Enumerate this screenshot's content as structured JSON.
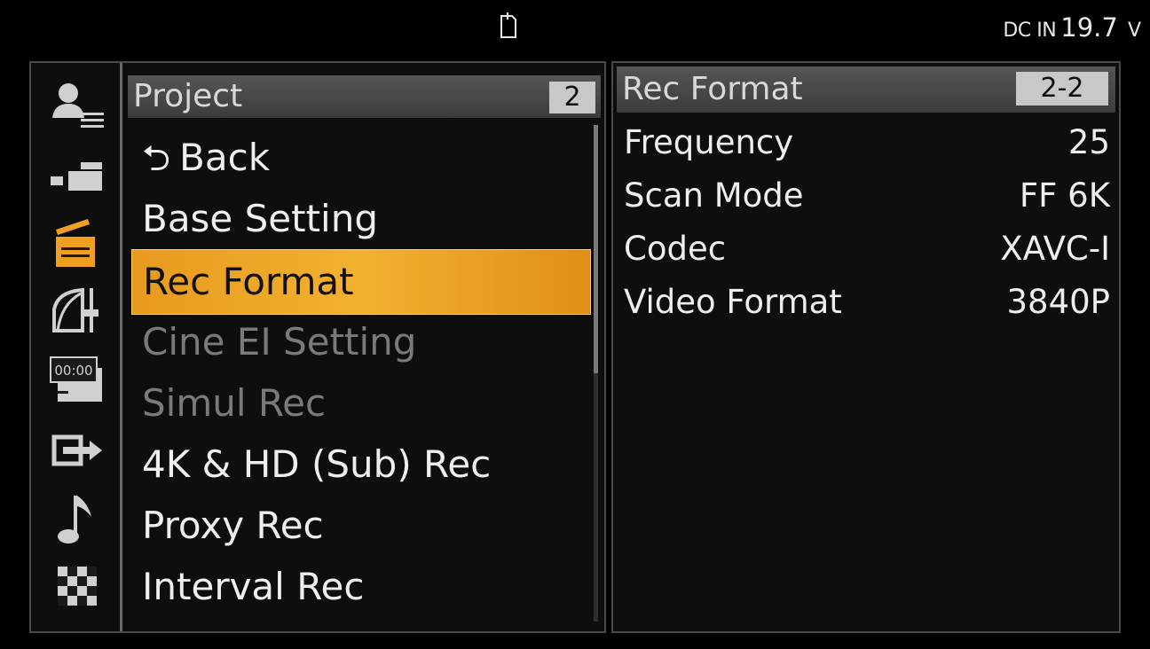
{
  "status_bar": {
    "media_icon": "memory-card-icon",
    "dc_in_label": "DC IN",
    "dc_in_value": "19.7",
    "dc_in_unit": "V"
  },
  "categories": [
    {
      "icon": "user-menu-icon",
      "active": false
    },
    {
      "icon": "camera-icon",
      "active": false
    },
    {
      "icon": "clapperboard-icon",
      "active": true
    },
    {
      "icon": "paint-gamma-icon",
      "active": false
    },
    {
      "icon": "timecode-icon",
      "active": false
    },
    {
      "icon": "output-icon",
      "active": false
    },
    {
      "icon": "audio-note-icon",
      "active": false
    },
    {
      "icon": "checker-icon",
      "active": false
    }
  ],
  "menu": {
    "title": "Project",
    "page": "2",
    "back_label": "Back",
    "items": [
      {
        "label": "Base Setting",
        "state": "normal"
      },
      {
        "label": "Rec Format",
        "state": "selected"
      },
      {
        "label": "Cine EI Setting",
        "state": "disabled"
      },
      {
        "label": "Simul Rec",
        "state": "disabled"
      },
      {
        "label": "4K & HD (Sub) Rec",
        "state": "normal"
      },
      {
        "label": "Proxy Rec",
        "state": "normal"
      },
      {
        "label": "Interval Rec",
        "state": "normal"
      }
    ]
  },
  "detail": {
    "title": "Rec Format",
    "page": "2-2",
    "rows": [
      {
        "label": "Frequency",
        "value": "25"
      },
      {
        "label": "Scan Mode",
        "value": "FF 6K"
      },
      {
        "label": "Codec",
        "value": "XAVC-I"
      },
      {
        "label": "Video Format",
        "value": "3840P"
      }
    ]
  },
  "colors": {
    "selection": "#f2b131",
    "active_icon": "#f0a020",
    "icon": "#d0d0d0",
    "disabled_text": "#7a7a7a"
  }
}
